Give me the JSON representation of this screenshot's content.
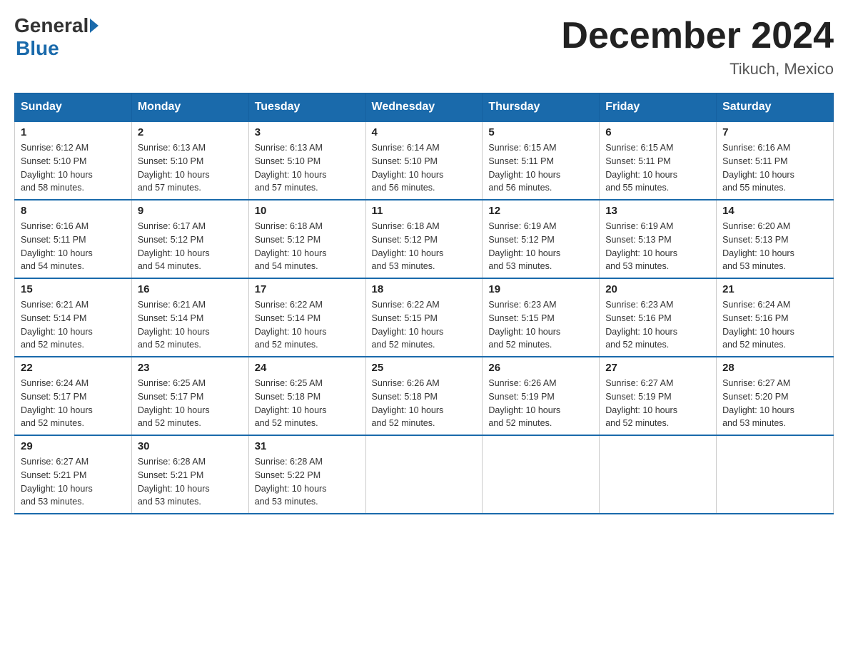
{
  "header": {
    "logo": {
      "general": "General",
      "blue": "Blue"
    },
    "title": "December 2024",
    "location": "Tikuch, Mexico"
  },
  "calendar": {
    "days_of_week": [
      "Sunday",
      "Monday",
      "Tuesday",
      "Wednesday",
      "Thursday",
      "Friday",
      "Saturday"
    ],
    "weeks": [
      [
        {
          "day": "1",
          "sunrise": "6:12 AM",
          "sunset": "5:10 PM",
          "daylight": "10 hours and 58 minutes."
        },
        {
          "day": "2",
          "sunrise": "6:13 AM",
          "sunset": "5:10 PM",
          "daylight": "10 hours and 57 minutes."
        },
        {
          "day": "3",
          "sunrise": "6:13 AM",
          "sunset": "5:10 PM",
          "daylight": "10 hours and 57 minutes."
        },
        {
          "day": "4",
          "sunrise": "6:14 AM",
          "sunset": "5:10 PM",
          "daylight": "10 hours and 56 minutes."
        },
        {
          "day": "5",
          "sunrise": "6:15 AM",
          "sunset": "5:11 PM",
          "daylight": "10 hours and 56 minutes."
        },
        {
          "day": "6",
          "sunrise": "6:15 AM",
          "sunset": "5:11 PM",
          "daylight": "10 hours and 55 minutes."
        },
        {
          "day": "7",
          "sunrise": "6:16 AM",
          "sunset": "5:11 PM",
          "daylight": "10 hours and 55 minutes."
        }
      ],
      [
        {
          "day": "8",
          "sunrise": "6:16 AM",
          "sunset": "5:11 PM",
          "daylight": "10 hours and 54 minutes."
        },
        {
          "day": "9",
          "sunrise": "6:17 AM",
          "sunset": "5:12 PM",
          "daylight": "10 hours and 54 minutes."
        },
        {
          "day": "10",
          "sunrise": "6:18 AM",
          "sunset": "5:12 PM",
          "daylight": "10 hours and 54 minutes."
        },
        {
          "day": "11",
          "sunrise": "6:18 AM",
          "sunset": "5:12 PM",
          "daylight": "10 hours and 53 minutes."
        },
        {
          "day": "12",
          "sunrise": "6:19 AM",
          "sunset": "5:12 PM",
          "daylight": "10 hours and 53 minutes."
        },
        {
          "day": "13",
          "sunrise": "6:19 AM",
          "sunset": "5:13 PM",
          "daylight": "10 hours and 53 minutes."
        },
        {
          "day": "14",
          "sunrise": "6:20 AM",
          "sunset": "5:13 PM",
          "daylight": "10 hours and 53 minutes."
        }
      ],
      [
        {
          "day": "15",
          "sunrise": "6:21 AM",
          "sunset": "5:14 PM",
          "daylight": "10 hours and 52 minutes."
        },
        {
          "day": "16",
          "sunrise": "6:21 AM",
          "sunset": "5:14 PM",
          "daylight": "10 hours and 52 minutes."
        },
        {
          "day": "17",
          "sunrise": "6:22 AM",
          "sunset": "5:14 PM",
          "daylight": "10 hours and 52 minutes."
        },
        {
          "day": "18",
          "sunrise": "6:22 AM",
          "sunset": "5:15 PM",
          "daylight": "10 hours and 52 minutes."
        },
        {
          "day": "19",
          "sunrise": "6:23 AM",
          "sunset": "5:15 PM",
          "daylight": "10 hours and 52 minutes."
        },
        {
          "day": "20",
          "sunrise": "6:23 AM",
          "sunset": "5:16 PM",
          "daylight": "10 hours and 52 minutes."
        },
        {
          "day": "21",
          "sunrise": "6:24 AM",
          "sunset": "5:16 PM",
          "daylight": "10 hours and 52 minutes."
        }
      ],
      [
        {
          "day": "22",
          "sunrise": "6:24 AM",
          "sunset": "5:17 PM",
          "daylight": "10 hours and 52 minutes."
        },
        {
          "day": "23",
          "sunrise": "6:25 AM",
          "sunset": "5:17 PM",
          "daylight": "10 hours and 52 minutes."
        },
        {
          "day": "24",
          "sunrise": "6:25 AM",
          "sunset": "5:18 PM",
          "daylight": "10 hours and 52 minutes."
        },
        {
          "day": "25",
          "sunrise": "6:26 AM",
          "sunset": "5:18 PM",
          "daylight": "10 hours and 52 minutes."
        },
        {
          "day": "26",
          "sunrise": "6:26 AM",
          "sunset": "5:19 PM",
          "daylight": "10 hours and 52 minutes."
        },
        {
          "day": "27",
          "sunrise": "6:27 AM",
          "sunset": "5:19 PM",
          "daylight": "10 hours and 52 minutes."
        },
        {
          "day": "28",
          "sunrise": "6:27 AM",
          "sunset": "5:20 PM",
          "daylight": "10 hours and 53 minutes."
        }
      ],
      [
        {
          "day": "29",
          "sunrise": "6:27 AM",
          "sunset": "5:21 PM",
          "daylight": "10 hours and 53 minutes."
        },
        {
          "day": "30",
          "sunrise": "6:28 AM",
          "sunset": "5:21 PM",
          "daylight": "10 hours and 53 minutes."
        },
        {
          "day": "31",
          "sunrise": "6:28 AM",
          "sunset": "5:22 PM",
          "daylight": "10 hours and 53 minutes."
        },
        null,
        null,
        null,
        null
      ]
    ],
    "labels": {
      "sunrise": "Sunrise:",
      "sunset": "Sunset:",
      "daylight": "Daylight:"
    }
  }
}
